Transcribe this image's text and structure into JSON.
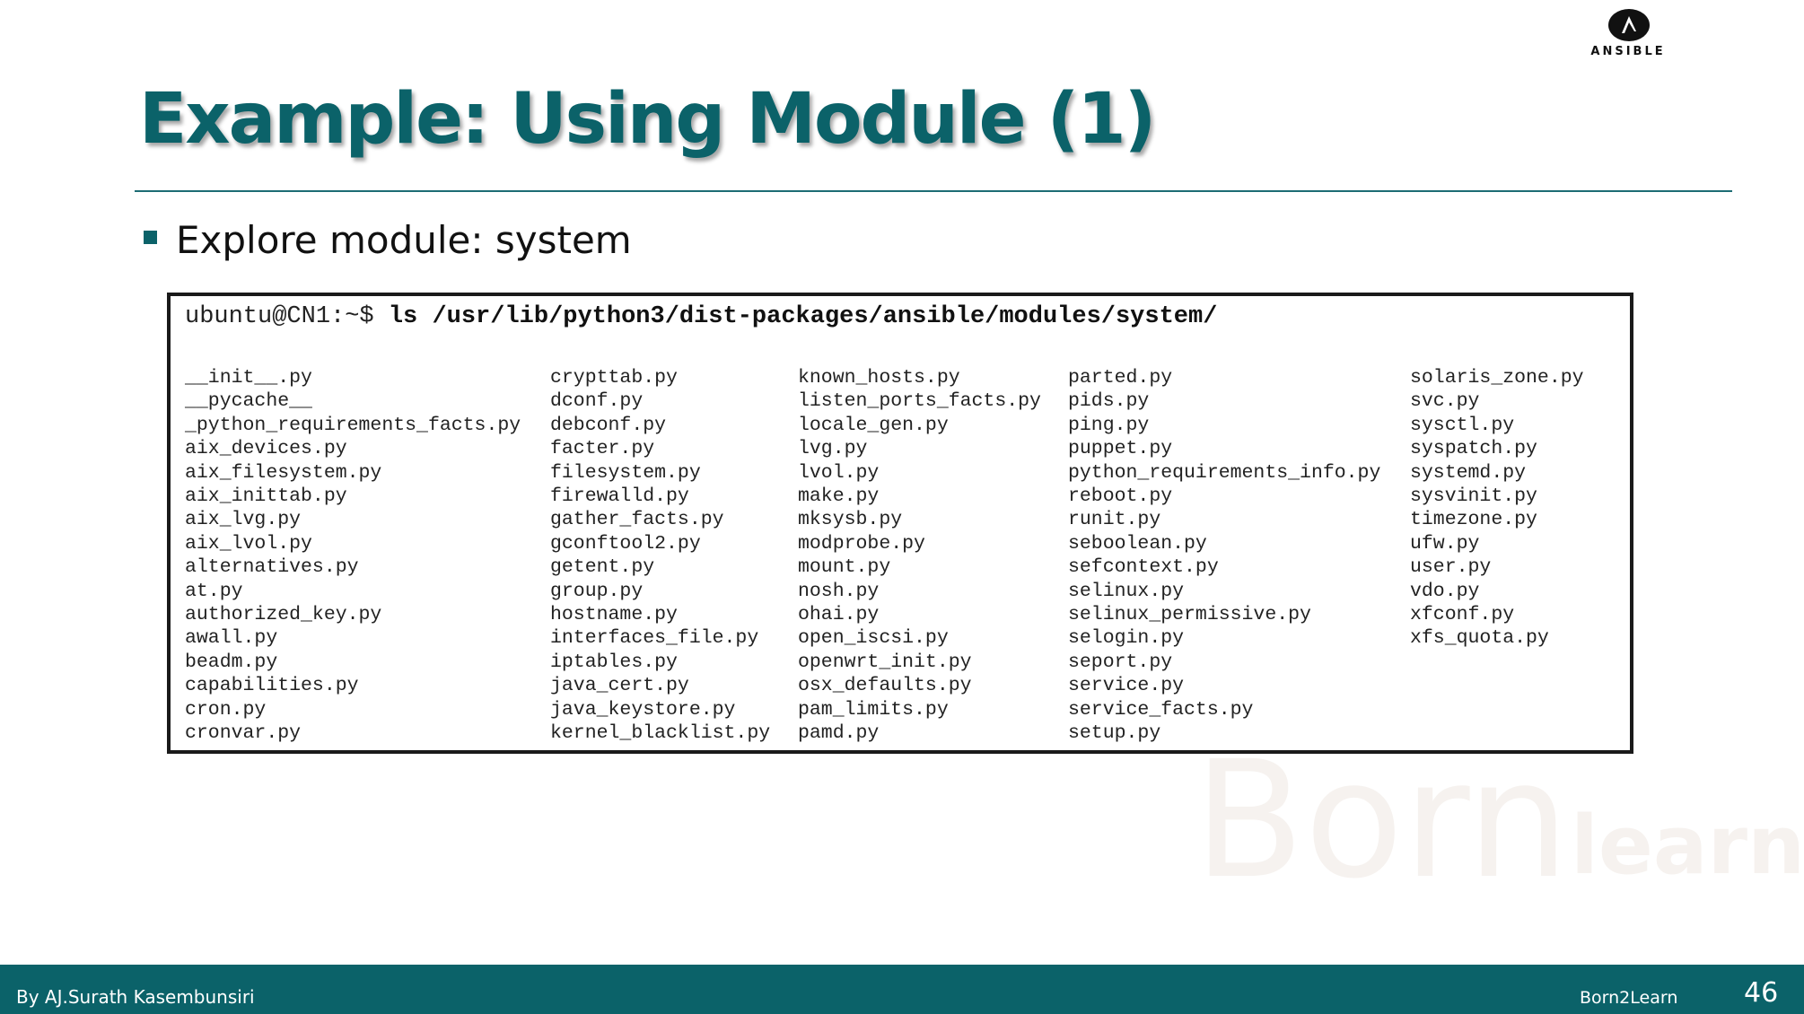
{
  "logo": {
    "text": "ANSIBLE",
    "icon": "ansible-logo-icon"
  },
  "slide": {
    "title": "Example: Using Module (1)",
    "bullet": "Explore module: system"
  },
  "terminal": {
    "prompt": "ubuntu@CN1:~$ ",
    "command": "ls /usr/lib/python3/dist-packages/ansible/modules/system/",
    "columns": [
      [
        "__init__.py",
        "__pycache__",
        "_python_requirements_facts.py",
        "aix_devices.py",
        "aix_filesystem.py",
        "aix_inittab.py",
        "aix_lvg.py",
        "aix_lvol.py",
        "alternatives.py",
        "at.py",
        "authorized_key.py",
        "awall.py",
        "beadm.py",
        "capabilities.py",
        "cron.py",
        "cronvar.py"
      ],
      [
        "crypttab.py",
        "dconf.py",
        "debconf.py",
        "facter.py",
        "filesystem.py",
        "firewalld.py",
        "gather_facts.py",
        "gconftool2.py",
        "getent.py",
        "group.py",
        "hostname.py",
        "interfaces_file.py",
        "iptables.py",
        "java_cert.py",
        "java_keystore.py",
        "kernel_blacklist.py"
      ],
      [
        "known_hosts.py",
        "listen_ports_facts.py",
        "locale_gen.py",
        "lvg.py",
        "lvol.py",
        "make.py",
        "mksysb.py",
        "modprobe.py",
        "mount.py",
        "nosh.py",
        "ohai.py",
        "open_iscsi.py",
        "openwrt_init.py",
        "osx_defaults.py",
        "pam_limits.py",
        "pamd.py"
      ],
      [
        "parted.py",
        "pids.py",
        "ping.py",
        "puppet.py",
        "python_requirements_info.py",
        "reboot.py",
        "runit.py",
        "seboolean.py",
        "sefcontext.py",
        "selinux.py",
        "selinux_permissive.py",
        "selogin.py",
        "seport.py",
        "service.py",
        "service_facts.py",
        "setup.py"
      ],
      [
        "solaris_zone.py",
        "svc.py",
        "sysctl.py",
        "syspatch.py",
        "systemd.py",
        "sysvinit.py",
        "timezone.py",
        "ufw.py",
        "user.py",
        "vdo.py",
        "xfconf.py",
        "xfs_quota.py"
      ]
    ]
  },
  "watermark": {
    "text_born": "Born",
    "text_learn": "learn"
  },
  "footer": {
    "author": "By AJ.Surath Kasembunsiri",
    "brand": "Born2Learn",
    "page_number": "46"
  },
  "colors": {
    "accent": "#0b6269",
    "footer_bg": "#0b6269",
    "text": "#111111"
  }
}
